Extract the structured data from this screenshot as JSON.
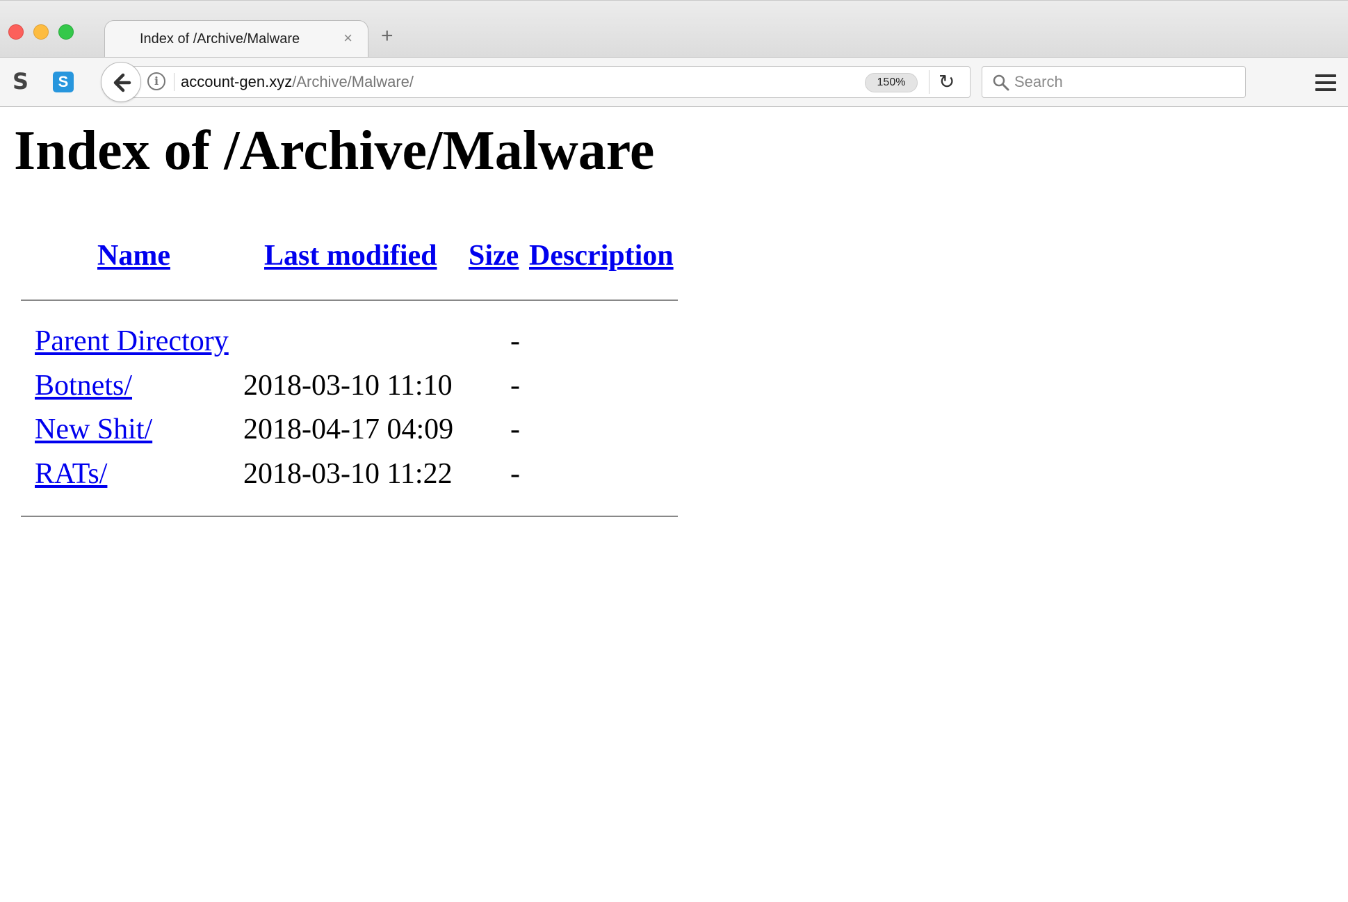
{
  "browser": {
    "tab": {
      "title": "Index of /Archive/Malware",
      "close_glyph": "×"
    },
    "new_tab_glyph": "+",
    "url": {
      "host": "account-gen.xyz",
      "path": "/Archive/Malware/"
    },
    "zoom": "150%",
    "search_placeholder": "Search",
    "extensions": {
      "s_label": "S",
      "skype_label": "S"
    }
  },
  "page": {
    "heading": "Index of /Archive/Malware",
    "columns": {
      "name": "Name",
      "last_modified": "Last modified",
      "size": "Size",
      "description": "Description"
    },
    "rows": [
      {
        "name": "Parent Directory",
        "modified": "",
        "size": "-"
      },
      {
        "name": "Botnets/",
        "modified": "2018-03-10 11:10",
        "size": "-"
      },
      {
        "name": "New Shit/",
        "modified": "2018-04-17 04:09",
        "size": "-"
      },
      {
        "name": "RATs/",
        "modified": "2018-03-10 11:22",
        "size": "-"
      }
    ]
  }
}
